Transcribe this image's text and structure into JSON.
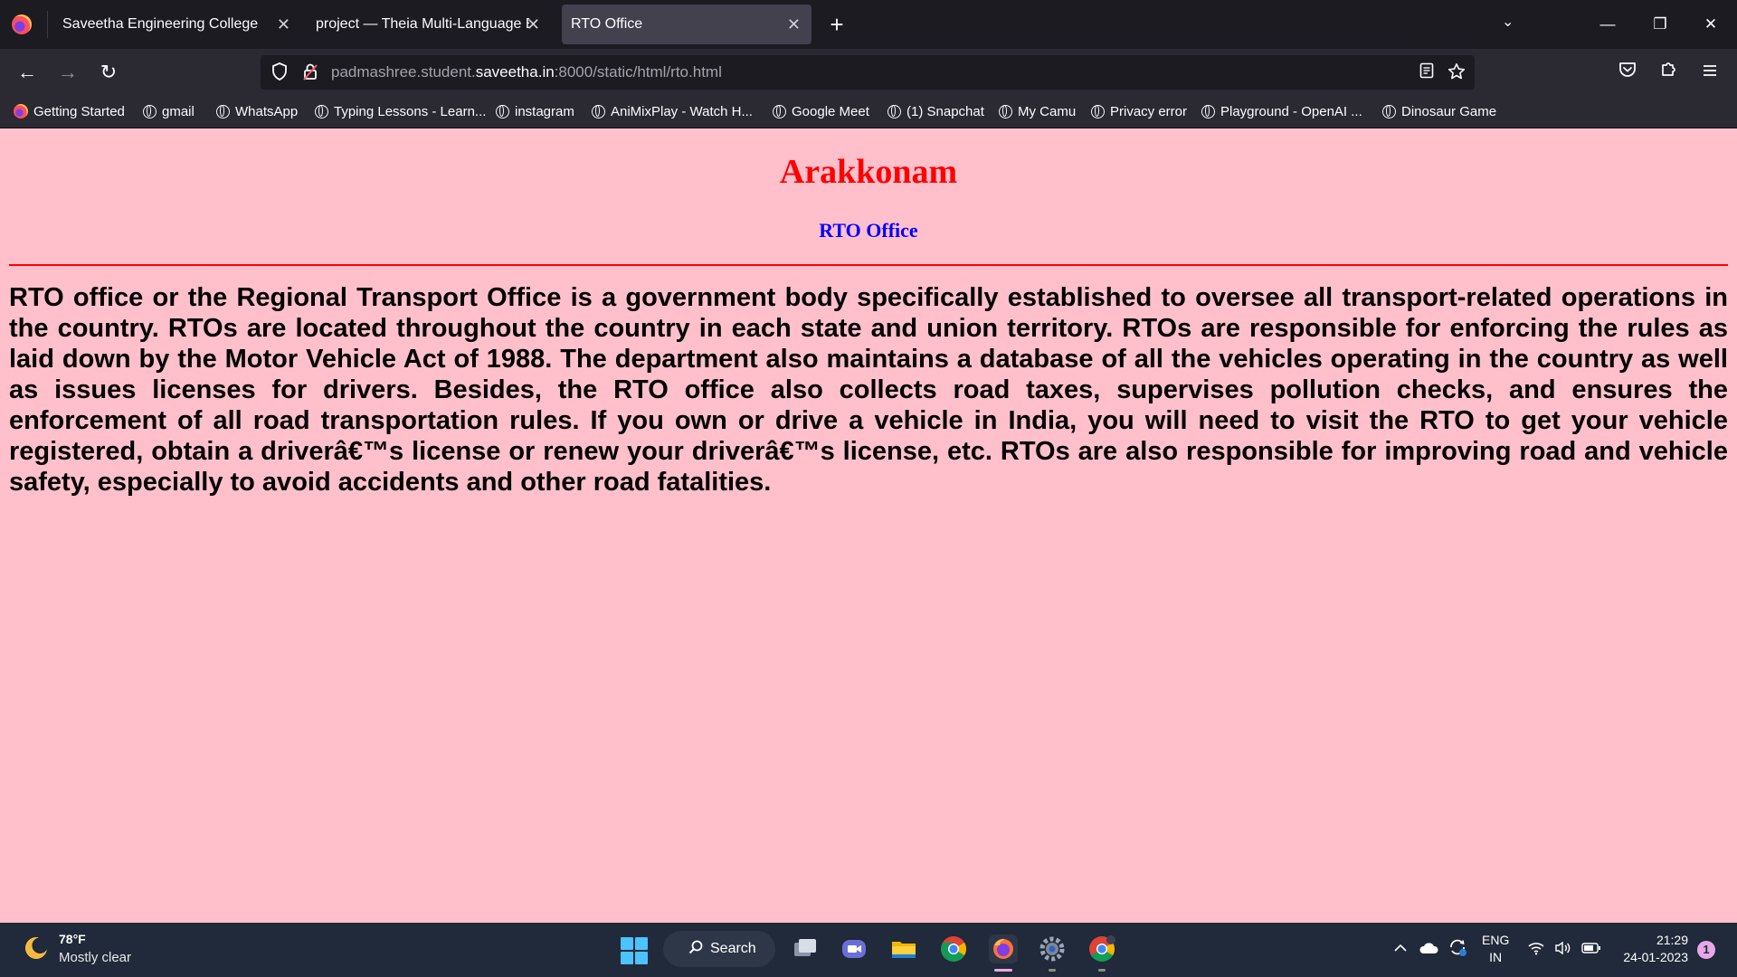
{
  "browser": {
    "tabs": [
      {
        "label": "Saveetha Engineering College",
        "active": false
      },
      {
        "label": "project — Theia Multi-Language Ex",
        "active": false
      },
      {
        "label": "RTO Office",
        "active": true
      }
    ],
    "tab_close_glyph": "✕",
    "new_tab_glyph": "+",
    "list_tabs_glyph": "⌄",
    "window_controls": {
      "minimize": "—",
      "restore": "❐",
      "close": "✕"
    },
    "nav": {
      "back": "←",
      "forward": "→",
      "reload": "↻"
    },
    "url": {
      "prefix": "padmashree.student.",
      "host": "saveetha.in",
      "suffix": ":8000/static/html/rto.html"
    },
    "toolbar_icons": [
      "reader-view-icon",
      "bookmark-star-icon",
      "pocket-icon",
      "extensions-icon",
      "menu-icon"
    ],
    "bookmarks": [
      {
        "label": "Getting Started",
        "icon": "firefox-icon"
      },
      {
        "label": "gmail",
        "icon": "globe-icon"
      },
      {
        "label": "WhatsApp",
        "icon": "globe-icon"
      },
      {
        "label": "Typing Lessons - Learn...",
        "icon": "globe-icon"
      },
      {
        "label": "instagram",
        "icon": "globe-icon"
      },
      {
        "label": "AniMixPlay - Watch H...",
        "icon": "globe-icon"
      },
      {
        "label": "Google Meet",
        "icon": "globe-icon"
      },
      {
        "label": "(1) Snapchat",
        "icon": "globe-icon"
      },
      {
        "label": "My Camu",
        "icon": "globe-icon"
      },
      {
        "label": "Privacy error",
        "icon": "globe-icon"
      },
      {
        "label": "Playground - OpenAI ...",
        "icon": "globe-icon"
      },
      {
        "label": "Dinosaur Game",
        "icon": "globe-icon"
      }
    ]
  },
  "page": {
    "heading": "Arakkonam",
    "subheading": "RTO Office",
    "paragraph": "RTO office or the Regional Transport Office is a government body specifically established to oversee all transport-related operations in the country. RTOs are located throughout the country in each state and union territory. RTOs are responsible for enforcing the rules as laid down by the Motor Vehicle Act of 1988. The department also maintains a database of all the vehicles operating in the country as well as issues licenses for drivers. Besides, the RTO office also collects road taxes, supervises pollution checks, and ensures the enforcement of all road transportation rules. If you own or drive a vehicle in India, you will need to visit the RTO to get your vehicle registered, obtain a driverâ€™s license or renew your driverâ€™s license, etc. RTOs are also responsible for improving road and vehicle safety, especially to avoid accidents and other road fatalities.",
    "colors": {
      "background": "#ffc0cb",
      "heading": "#ff0000",
      "subheading": "#0000ff",
      "rule": "#ff0000"
    }
  },
  "taskbar": {
    "weather": {
      "temp": "78°F",
      "condition": "Mostly clear"
    },
    "search_label": "Search",
    "apps": [
      "task-view-icon",
      "teams-chat-icon",
      "file-explorer-icon",
      "chrome-icon",
      "firefox-icon",
      "settings-icon",
      "chrome-profile-icon"
    ],
    "tray": {
      "lang_line1": "ENG",
      "lang_line2": "IN",
      "time": "21:29",
      "date": "24-01-2023",
      "notifications": "1"
    }
  }
}
